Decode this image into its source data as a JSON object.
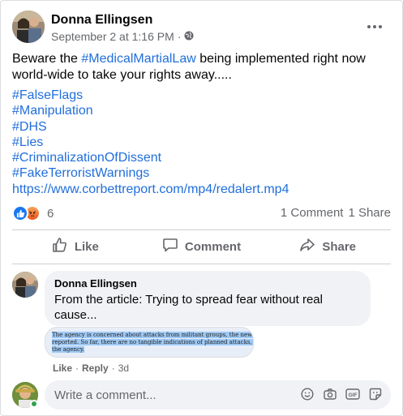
{
  "post": {
    "author": "Donna Ellingsen",
    "timestamp": "September 2 at 1:16 PM",
    "separator": "·",
    "audience_icon": "globe-icon",
    "text_before": "Beware the ",
    "hashtag_inline": "#MedicalMartialLaw",
    "text_after": " being implemented right now",
    "text_line2": "world-wide to take your rights away.....",
    "hashtags": [
      "#FalseFlags",
      "#Manipulation",
      "#DHS",
      "#Lies",
      "#CriminalizationOfDissent",
      "#FakeTerroristWarnings"
    ],
    "link": "https://www.corbettreport.com/mp4/redalert.mp4"
  },
  "reactions": {
    "icons": [
      "like-icon",
      "angry-icon"
    ],
    "count": "6",
    "comments": "1 Comment",
    "shares": "1 Share"
  },
  "actions": {
    "like": "Like",
    "comment": "Comment",
    "share": "Share"
  },
  "comment": {
    "author": "Donna Ellingsen",
    "text": "From the article: Trying to spread fear without real cause...",
    "image_lines": [
      "The agency is concerned about attacks from militant groups, the newspaper",
      "reported. So far, there are no tangible indications of planned attacks, according to",
      "the agency."
    ],
    "like": "Like",
    "reply": "Reply",
    "age": "3d",
    "dot": "·"
  },
  "composer": {
    "placeholder": "Write a comment...",
    "icons": [
      "emoji-icon",
      "camera-icon",
      "gif-icon",
      "sticker-icon"
    ]
  },
  "colors": {
    "link": "#216fdb",
    "secondary_text": "#65676b",
    "bubble": "#f0f2f5",
    "like_blue": "#1877f2"
  }
}
